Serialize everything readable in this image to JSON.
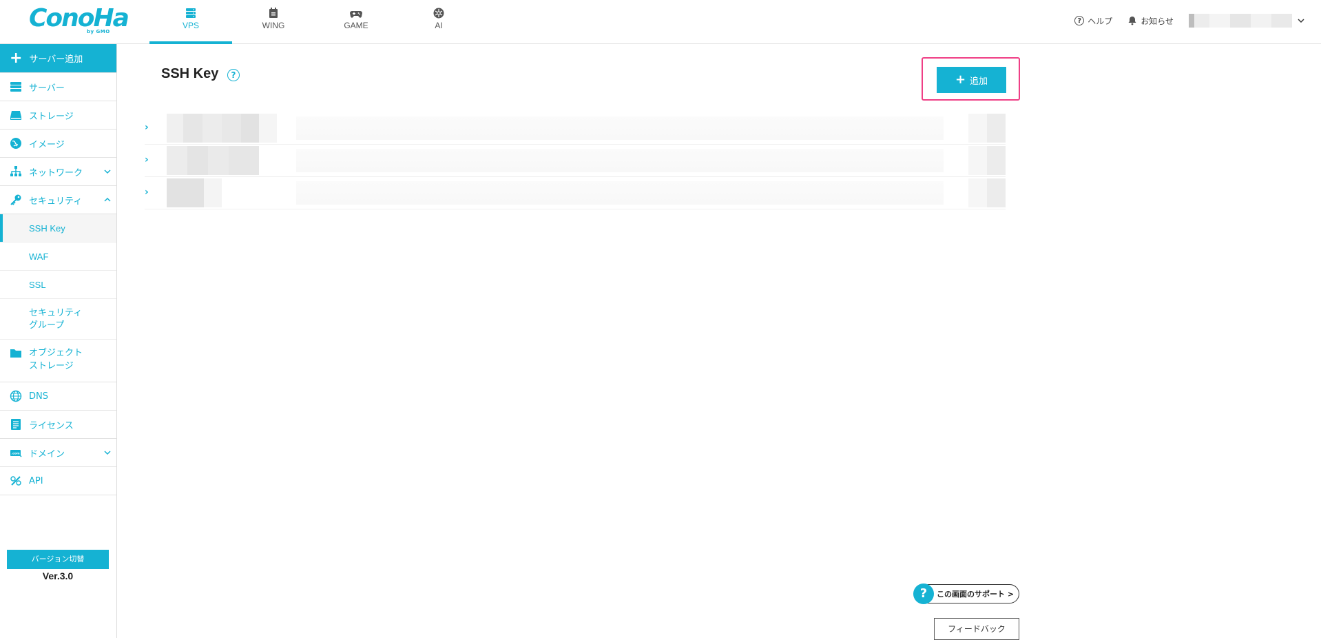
{
  "brand": {
    "logo_text": "ConoHa",
    "logo_sub": "by GMO",
    "accent": "#15b2d3"
  },
  "header": {
    "tabs": [
      {
        "label": "VPS",
        "icon": "server-icon",
        "active": true
      },
      {
        "label": "WING",
        "icon": "wing-icon",
        "active": false
      },
      {
        "label": "GAME",
        "icon": "gamepad-icon",
        "active": false
      },
      {
        "label": "AI",
        "icon": "ai-icon",
        "active": false
      }
    ],
    "help_label": "ヘルプ",
    "notice_label": "お知らせ"
  },
  "sidebar": {
    "add_server_label": "サーバー追加",
    "items": [
      {
        "label": "サーバー",
        "icon": "server-icon"
      },
      {
        "label": "ストレージ",
        "icon": "storage-icon"
      },
      {
        "label": "イメージ",
        "icon": "image-icon"
      },
      {
        "label": "ネットワーク",
        "icon": "network-icon",
        "expandable": true
      },
      {
        "label": "セキュリティ",
        "icon": "key-icon",
        "expanded": true
      }
    ],
    "security_sub": [
      {
        "label": "SSH Key",
        "active": true
      },
      {
        "label": "WAF"
      },
      {
        "label": "SSL"
      },
      {
        "label": "セキュリティ\nグループ"
      }
    ],
    "items2": [
      {
        "label": "オブジェクト\nストレージ",
        "icon": "folder-icon"
      },
      {
        "label": "DNS",
        "icon": "globe-icon"
      },
      {
        "label": "ライセンス",
        "icon": "license-icon"
      },
      {
        "label": "ドメイン",
        "icon": "domain-icon",
        "expandable": true
      },
      {
        "label": "API",
        "icon": "api-icon"
      }
    ],
    "version_button": "バージョン切替",
    "version_text": "Ver.3.0"
  },
  "main": {
    "title": "SSH Key",
    "add_button": "追加",
    "rows": [
      {
        "id": "row-1"
      },
      {
        "id": "row-2"
      },
      {
        "id": "row-3"
      }
    ],
    "support_label": "この画面のサポート >",
    "feedback_label": "フィードバック"
  }
}
